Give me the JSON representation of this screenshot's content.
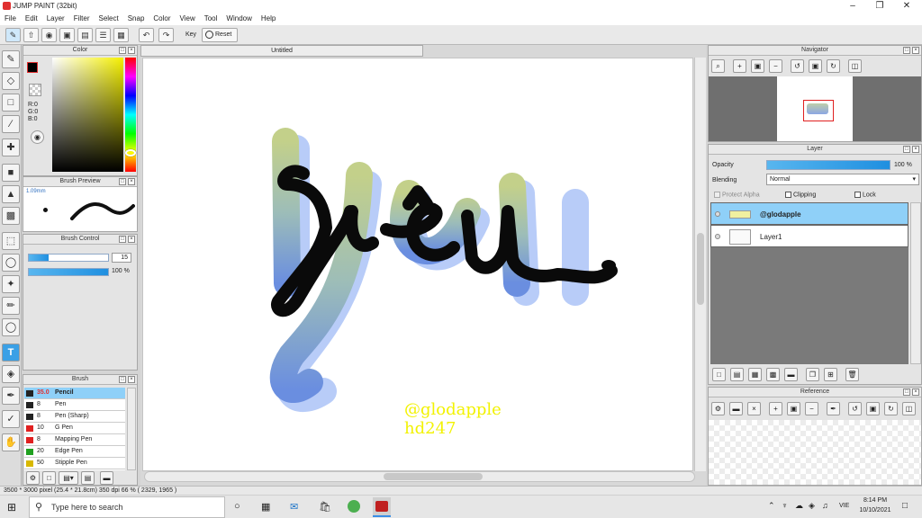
{
  "window": {
    "title": "JUMP PAINT (32bit)"
  },
  "menu": [
    "File",
    "Edit",
    "Layer",
    "Filter",
    "Select",
    "Snap",
    "Color",
    "View",
    "Tool",
    "Window",
    "Help"
  ],
  "toolbar": {
    "key_label": "Key",
    "reset_label": "Reset"
  },
  "color_panel": {
    "title": "Color",
    "r": "R:0",
    "g": "G:0",
    "b": "B:0"
  },
  "brush_preview": {
    "title": "Brush Preview",
    "size": "1.09mm"
  },
  "brush_control": {
    "title": "Brush Control",
    "size_value": "15",
    "size_fill": 0.25,
    "opacity_value": "100 %",
    "opacity_fill": 1.0
  },
  "brush_panel": {
    "title": "Brush",
    "items": [
      {
        "size": "35.0",
        "name": "Pencil",
        "color": "#222222",
        "selected": true
      },
      {
        "size": "8",
        "name": "Pen",
        "color": "#222222",
        "selected": false
      },
      {
        "size": "8",
        "name": "Pen (Sharp)",
        "color": "#222222",
        "selected": false
      },
      {
        "size": "10",
        "name": "G Pen",
        "color": "#e02020",
        "selected": false
      },
      {
        "size": "8",
        "name": "Mapping Pen",
        "color": "#e02020",
        "selected": false
      },
      {
        "size": "20",
        "name": "Edge Pen",
        "color": "#20a020",
        "selected": false
      },
      {
        "size": "50",
        "name": "Stipple Pen",
        "color": "#d8b800",
        "selected": false
      }
    ]
  },
  "canvas": {
    "tab_title": "Untitled",
    "watermark_line1": "@glodapple",
    "watermark_line2": "hd247"
  },
  "navigator": {
    "title": "Navigator"
  },
  "layer_panel": {
    "title": "Layer",
    "opacity_label": "Opacity",
    "opacity_value": "100 %",
    "blending_label": "Blending",
    "blending_value": "Normal",
    "protect_alpha": "Protect Alpha",
    "clipping": "Clipping",
    "lock": "Lock",
    "layers": [
      {
        "name": "@glodapple",
        "selected": true
      },
      {
        "name": "Layer1",
        "selected": false
      }
    ]
  },
  "reference_panel": {
    "title": "Reference"
  },
  "status": {
    "text": "3500 * 3000 pixel  (25.4 * 21.8cm)  350 dpi  66 %  ( 2329, 1965 )"
  },
  "taskbar": {
    "search_placeholder": "Type here to search",
    "lang": "VIE",
    "time": "8:14 PM",
    "date": "10/10/2021"
  },
  "colors": {
    "accent": "#3aa0e6",
    "selected_row": "#8fd0f8",
    "watermark": "#f2f200"
  }
}
